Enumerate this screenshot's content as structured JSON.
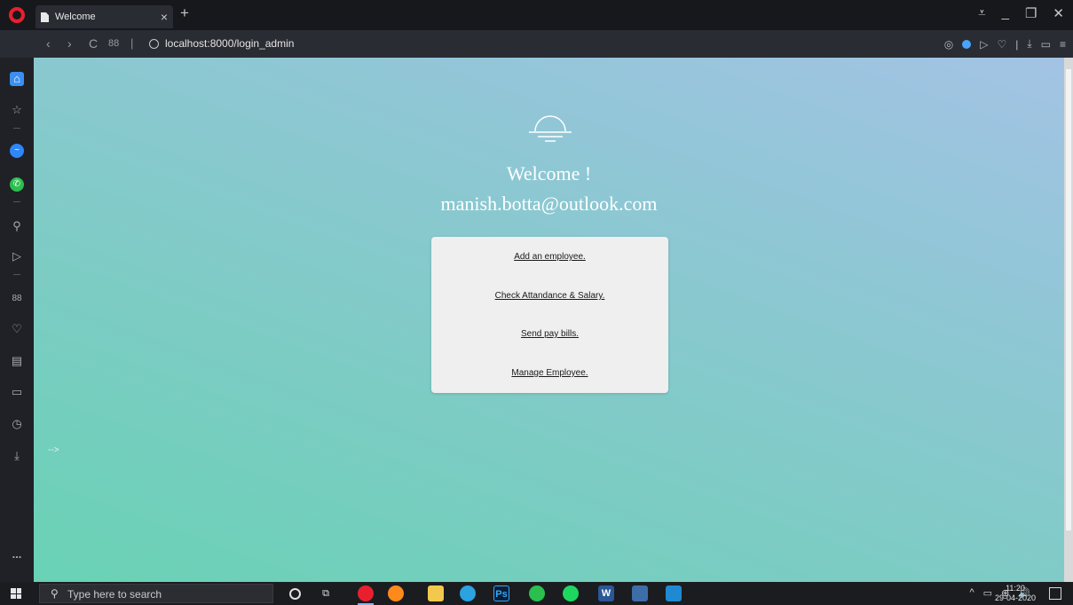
{
  "browser": {
    "tab_title": "Welcome",
    "tab_close": "×",
    "new_tab": "+",
    "url": "localhost:8000/login_admin",
    "url_separator": "|",
    "nav": {
      "back": "‹",
      "forward": "›",
      "reload": "C",
      "speed_dial": "88"
    },
    "window_controls": {
      "menu": "⩡",
      "minimize": "_",
      "restore": "❐",
      "close": "✕"
    },
    "toolbar_icons": [
      "camera-icon",
      "vpn-shield-icon",
      "flow-icon",
      "heart-icon",
      "download-icon",
      "battery-icon",
      "easy-setup-icon"
    ]
  },
  "sidebar": {
    "items": [
      "home-icon",
      "bookmarks-icon",
      "messenger-icon",
      "whatsapp-icon",
      "search-icon",
      "flow-icon",
      "speed-dial-icon",
      "heart-icon",
      "news-icon",
      "tabs-icon",
      "history-icon",
      "downloads-icon"
    ],
    "more": "..."
  },
  "page": {
    "welcome": "Welcome !",
    "email": "manish.botta@outlook.com",
    "links": [
      "Add an employee.",
      "Check Attandance & Salary.",
      "Send pay bills.",
      "Manage Employee."
    ],
    "stray_text": "-->"
  },
  "taskbar": {
    "search_placeholder": "Type here to search",
    "apps": [
      "cortana-icon",
      "task-view-icon",
      "opera-icon",
      "firefox-icon",
      "file-explorer-icon",
      "telegram-icon",
      "photoshop-icon",
      "whatsapp-icon",
      "spotify-icon",
      "word-icon",
      "tableau-icon",
      "vscode-icon"
    ],
    "photoshop_label": "Ps",
    "word_label": "W",
    "tray": {
      "chevron": "^",
      "volume": "🔊"
    },
    "time": "11:20",
    "date": "29-04-2020"
  },
  "colors": {
    "content_gradient_start": "#69d2b5",
    "content_gradient_end": "#a3c3e4",
    "card": "#efefef",
    "opera_red": "#e8202e"
  }
}
